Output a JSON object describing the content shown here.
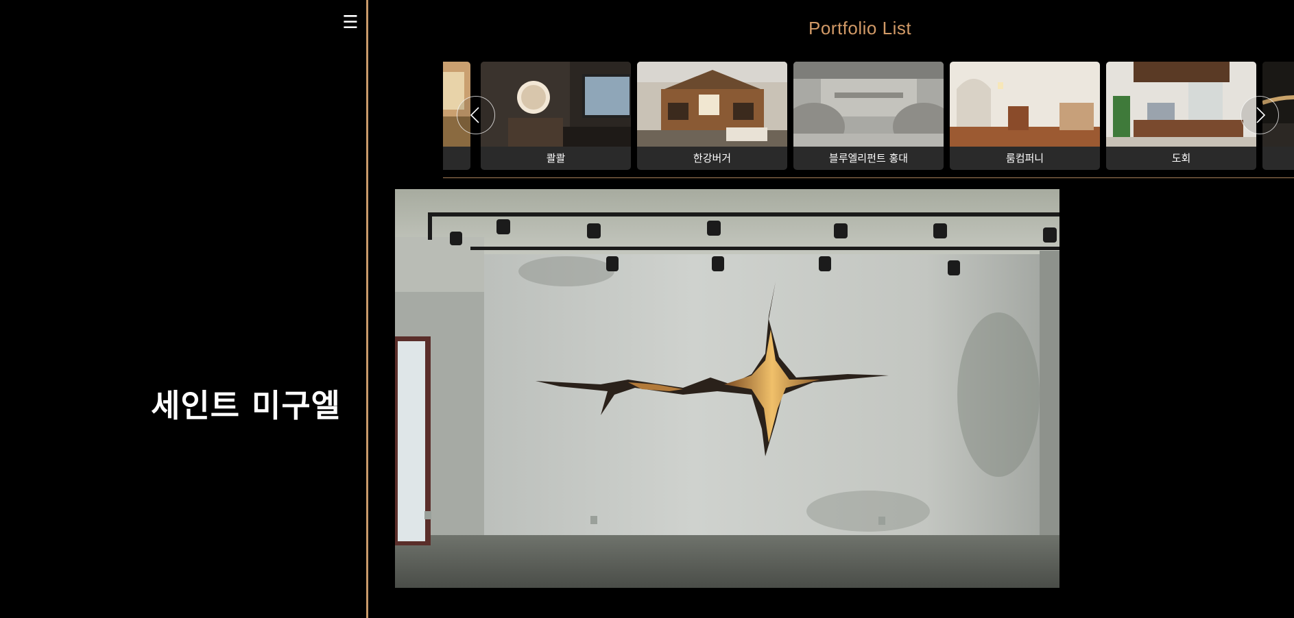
{
  "sidebar": {
    "menu_icon": "hamburger-menu-icon",
    "project_title": "세인트 미구엘"
  },
  "header": {
    "title": "Portfolio List"
  },
  "carousel": {
    "prev_icon": "chevron-left-icon",
    "next_icon": "chevron-right-icon",
    "items": [
      {
        "label": ""
      },
      {
        "label": "콸콸"
      },
      {
        "label": "한강버거"
      },
      {
        "label": "블루엘리펀트 홍대"
      },
      {
        "label": "룸컴퍼니"
      },
      {
        "label": "도회"
      },
      {
        "label": ""
      }
    ]
  },
  "main": {
    "image": "concrete-wall-crack-gallery-photo"
  },
  "colors": {
    "accent": "#d29a67",
    "divider": "#c99a6a",
    "card_bg": "#2a2a2a",
    "background": "#000000"
  }
}
